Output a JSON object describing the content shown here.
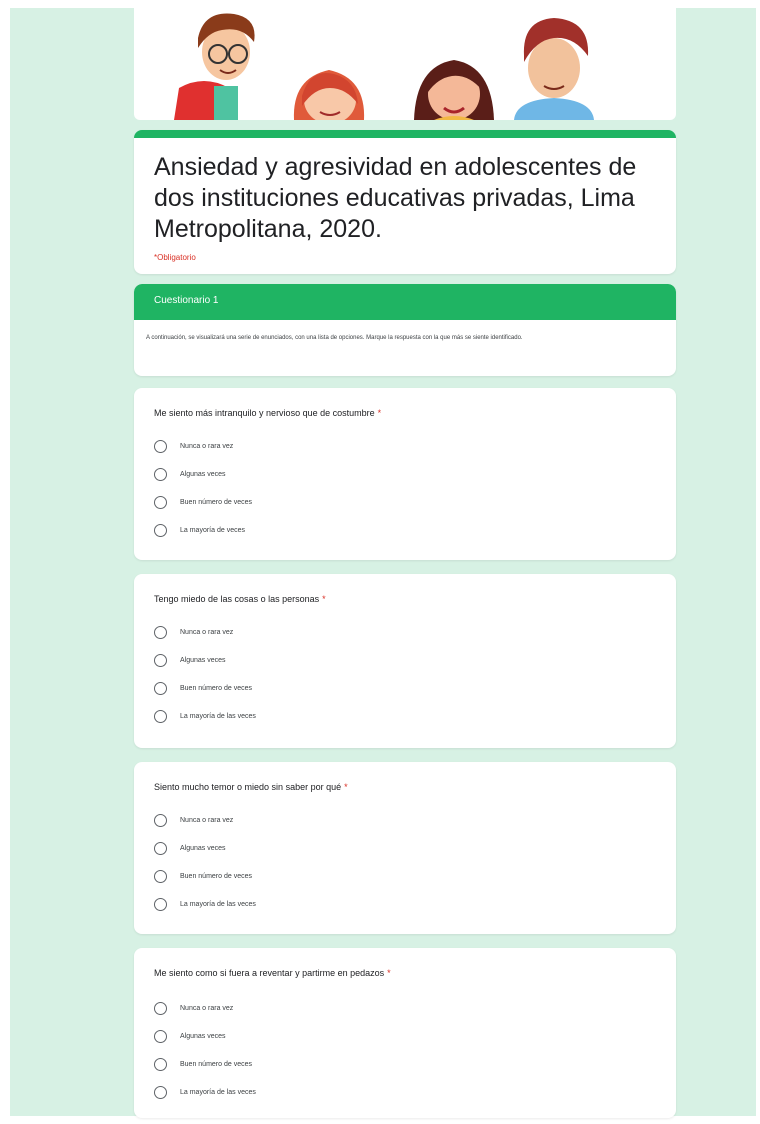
{
  "form": {
    "title": "Ansiedad y agresividad en adolescentes de dos instituciones educativas privadas, Lima Metropolitana, 2020.",
    "required_note": "*Obligatorio"
  },
  "section": {
    "title": "Cuestionario 1",
    "description": "A continuación, se visualizará una serie de enunciados, con una lista de opciones. Marque la respuesta con la que más se siente identificado."
  },
  "questions": [
    {
      "title": "Me siento más intranquilo y nervioso que de costumbre",
      "required": "*",
      "options": [
        "Nunca o rara vez",
        "Algunas veces",
        "Buen número de veces",
        "La mayoría de veces"
      ]
    },
    {
      "title": "Tengo miedo de las cosas o las personas",
      "required": "*",
      "options": [
        "Nunca o rara vez",
        "Algunas veces",
        "Buen número de veces",
        "La mayoría de las veces"
      ]
    },
    {
      "title": "Siento mucho temor o miedo sin saber por qué",
      "required": "*",
      "options": [
        "Nunca o rara vez",
        "Algunas veces",
        "Buen número de veces",
        "La mayoría de las veces"
      ]
    },
    {
      "title": "Me siento como si fuera a reventar y partirme en pedazos",
      "required": "*",
      "options": [
        "Nunca o rara vez",
        "Algunas veces",
        "Buen número de veces",
        "La mayoría de las veces"
      ]
    }
  ],
  "colors": {
    "accent": "#1fb463",
    "background": "#d7f1e4",
    "required": "#d93025"
  },
  "icons": [
    "radio-button-icon"
  ]
}
